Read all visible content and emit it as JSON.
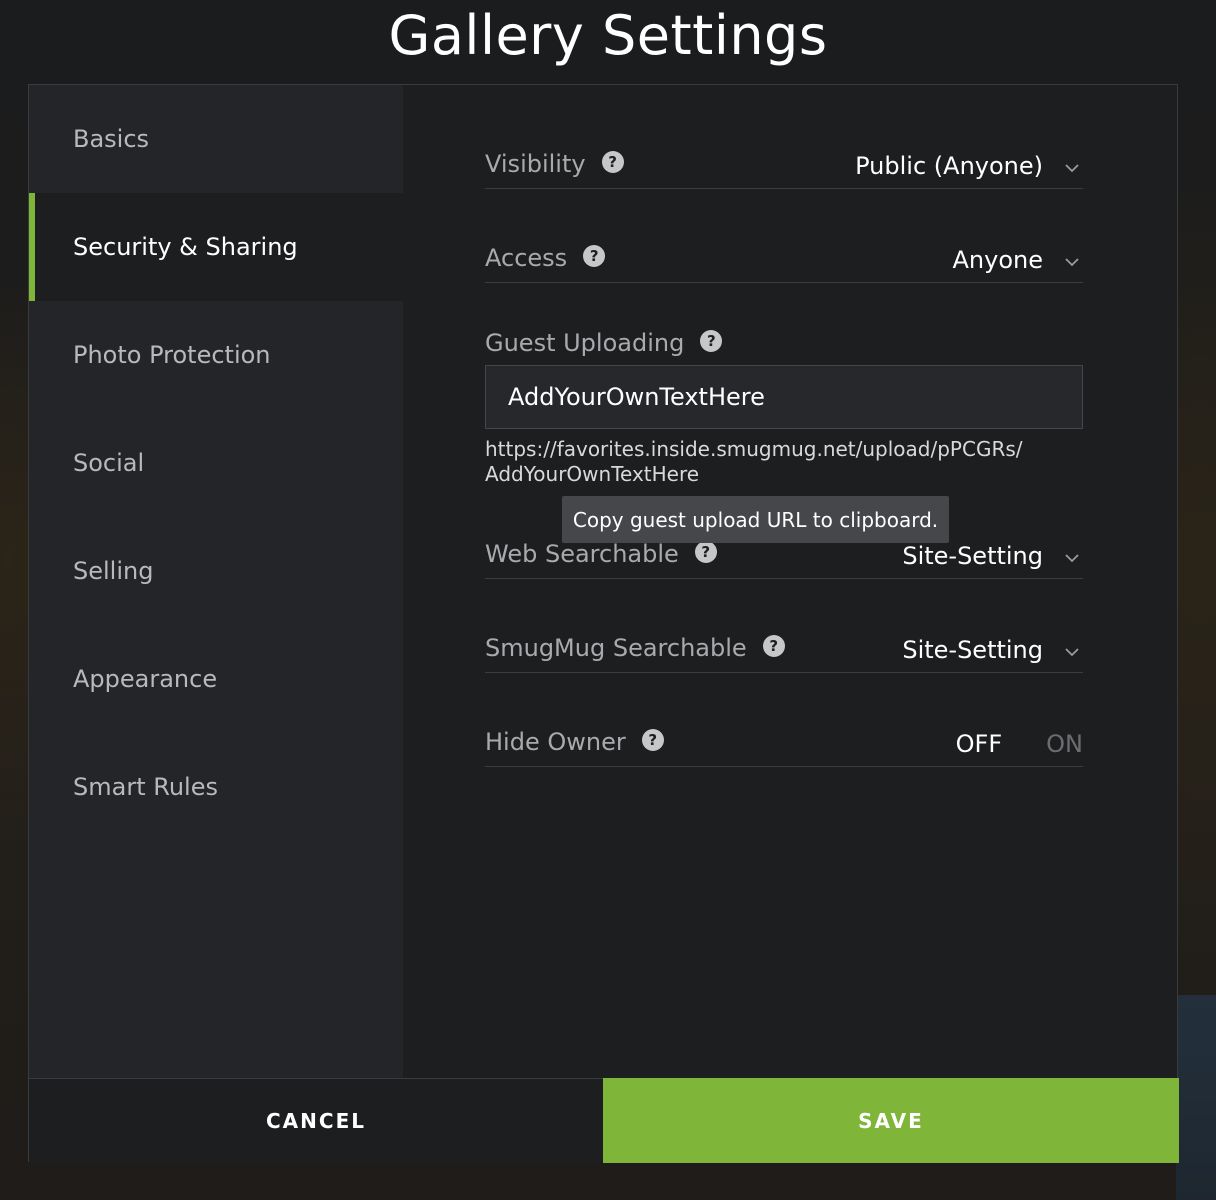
{
  "dialog": {
    "title": "Gallery Settings"
  },
  "sidebar": {
    "items": [
      {
        "label": "Basics",
        "active": false
      },
      {
        "label": "Security & Sharing",
        "active": true
      },
      {
        "label": "Photo Protection",
        "active": false
      },
      {
        "label": "Social",
        "active": false
      },
      {
        "label": "Selling",
        "active": false
      },
      {
        "label": "Appearance",
        "active": false
      },
      {
        "label": "Smart Rules",
        "active": false
      }
    ]
  },
  "settings": {
    "visibility": {
      "label": "Visibility",
      "value": "Public (Anyone)"
    },
    "access": {
      "label": "Access",
      "value": "Anyone"
    },
    "guest_uploading": {
      "label": "Guest Uploading",
      "input_value": "AddYourOwnTextHere",
      "url_line1": "https://favorites.inside.smugmug.net/upload/pPCGRs/",
      "url_line2": "AddYourOwnTextHere",
      "tooltip": "Copy guest upload URL to clipboard."
    },
    "web_searchable": {
      "label": "Web Searchable",
      "value": "Site-Setting"
    },
    "smugmug_searchable": {
      "label": "SmugMug Searchable",
      "value": "Site-Setting"
    },
    "hide_owner": {
      "label": "Hide Owner",
      "off_label": "OFF",
      "on_label": "ON",
      "state": "off"
    }
  },
  "help_glyph": "?",
  "footer": {
    "cancel_label": "CANCEL",
    "save_label": "SAVE"
  },
  "colors": {
    "accent": "#7fb538",
    "background": "#1d1e20",
    "sidebar": "#242528"
  }
}
